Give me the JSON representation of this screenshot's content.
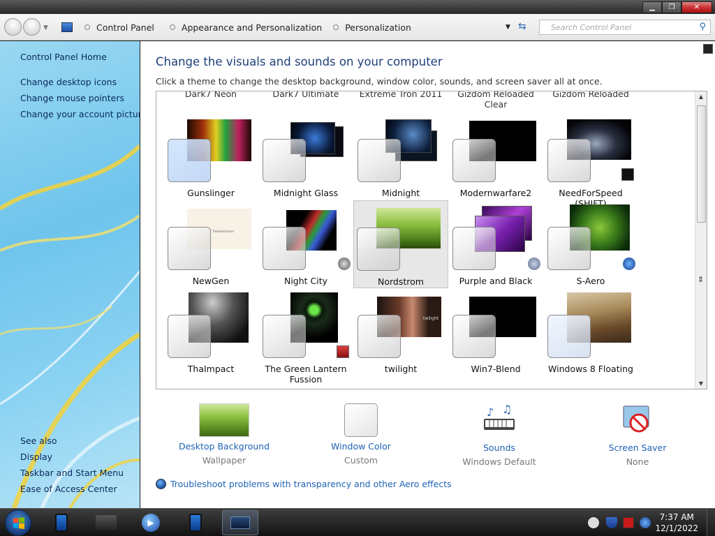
{
  "window": {
    "min_label": "▁",
    "max_label": "❐",
    "close_label": "✕"
  },
  "address": {
    "crumbs": [
      "Control Panel",
      "Appearance and Personalization",
      "Personalization"
    ],
    "search_placeholder": "Search Control Panel"
  },
  "sidebar": {
    "home": "Control Panel Home",
    "links": [
      "Change desktop icons",
      "Change mouse pointers",
      "Change your account picture"
    ],
    "see_also": "See also",
    "see_also_links": [
      "Display",
      "Taskbar and Start Menu",
      "Ease of Access Center"
    ]
  },
  "main": {
    "title": "Change the visuals and sounds on your computer",
    "subtitle": "Click a theme to change the desktop background, window color, sounds, and screen saver all at once."
  },
  "themes_cut": [
    "Dark7 Neon",
    "Dark7 Ultimate",
    "Extreme Tron 2011",
    "Gizdom Reloaded Clear",
    "Gizdom Reloaded"
  ],
  "themes": [
    {
      "name": "Gunslinger"
    },
    {
      "name": "Midnight Glass"
    },
    {
      "name": "Midnight"
    },
    {
      "name": "Modernwarfare2"
    },
    {
      "name": "NeedForSpeed (SHIFT)"
    },
    {
      "name": "NewGen",
      "thumb_text": "TheGeekGamer"
    },
    {
      "name": "Night City"
    },
    {
      "name": "Nordstrom",
      "selected": true
    },
    {
      "name": "Purple and Black"
    },
    {
      "name": "S-Aero"
    },
    {
      "name": "ThaImpact"
    },
    {
      "name": "The Green Lantern Fussion"
    },
    {
      "name": "twilight",
      "thumb_text": "twilight"
    },
    {
      "name": "Win7-Blend"
    },
    {
      "name": "Windows 8 Floating"
    }
  ],
  "options": [
    {
      "label": "Desktop Background",
      "value": "Wallpaper",
      "icon": "wallpaper-icon"
    },
    {
      "label": "Window Color",
      "value": "Custom",
      "icon": "window-color-icon"
    },
    {
      "label": "Sounds",
      "value": "Windows Default",
      "icon": "sounds-icon"
    },
    {
      "label": "Screen Saver",
      "value": "None",
      "icon": "screen-saver-icon"
    }
  ],
  "troubleshoot": "Troubleshoot problems with transparency and other Aero effects",
  "taskbar": {
    "time": "7:37 AM",
    "date": "12/1/2022"
  }
}
